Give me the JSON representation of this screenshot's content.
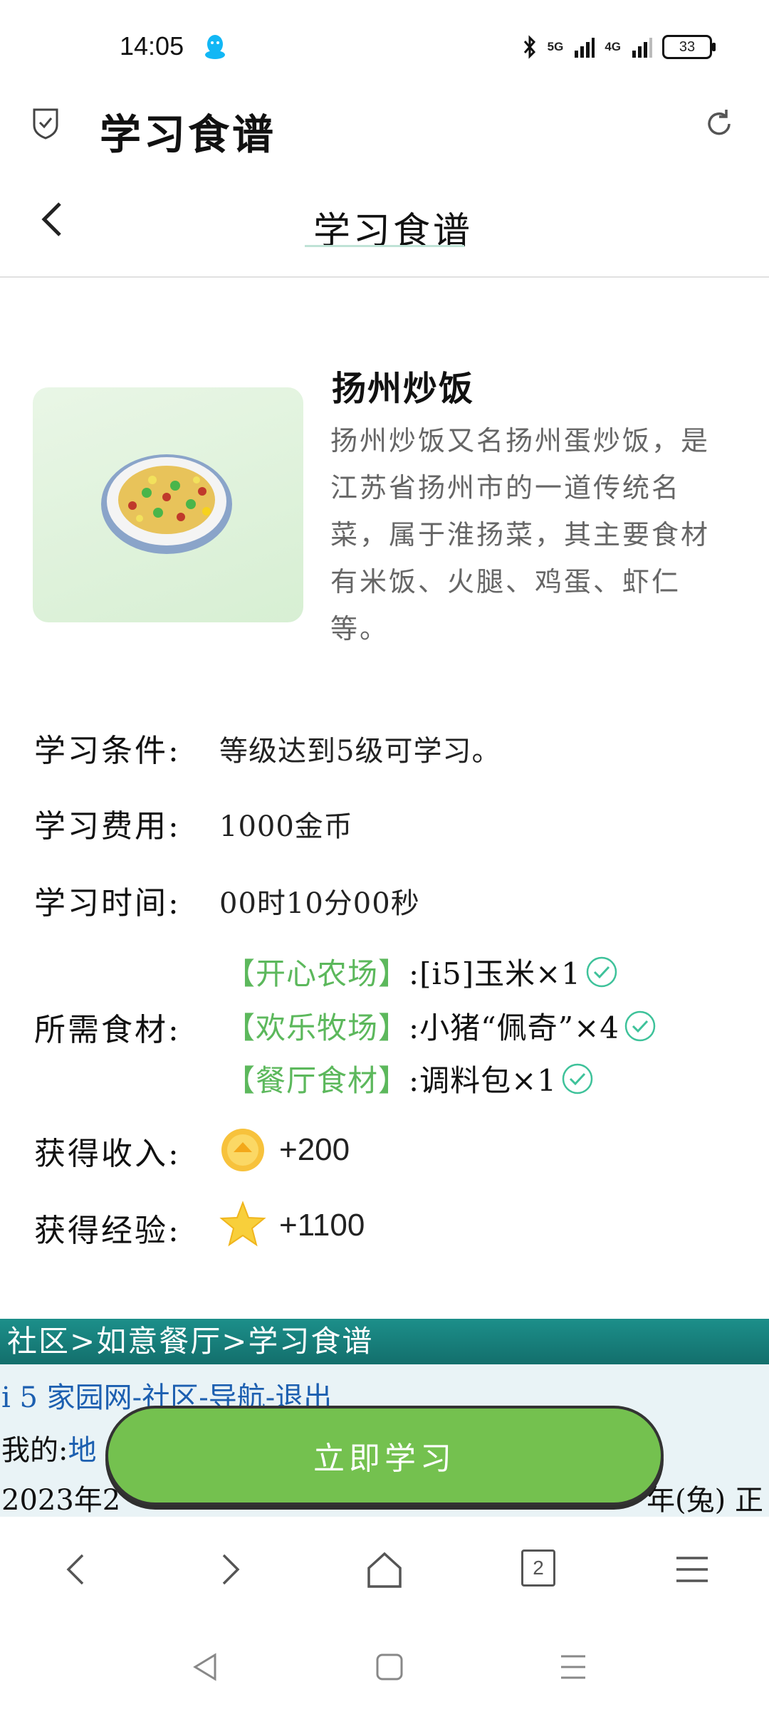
{
  "status": {
    "time": "14:05",
    "net1": "5G",
    "net2": "4G",
    "battery": "33"
  },
  "header": {
    "title": "学习食谱"
  },
  "nav": {
    "title": "学习食谱"
  },
  "recipe": {
    "name": "扬州炒饭",
    "description_lines": [
      "扬州炒饭又名扬州蛋炒饭，是",
      "江苏省扬州市的一道传统名",
      "菜，属于淮扬菜，其主要食材",
      "有米饭、火腿、鸡蛋、虾仁",
      "等。"
    ]
  },
  "condition": {
    "label": "学习条件:",
    "value": "等级达到5级可学习。"
  },
  "cost": {
    "label": "学习费用:",
    "value": "1000金币"
  },
  "time": {
    "label": "学习时间:",
    "value": "00时10分00秒"
  },
  "ingredients": {
    "label": "所需食材:",
    "items": [
      {
        "source": "【开心农场】",
        "item": ":[i5]玉米×1"
      },
      {
        "source": "【欢乐牧场】",
        "item": ":小猪“佩奇”×4"
      },
      {
        "source": "【餐厅食材】",
        "item": ":调料包×1"
      }
    ]
  },
  "income": {
    "label": "获得收入:",
    "value": "+200"
  },
  "exp": {
    "label": "获得经验:",
    "value": "+1100"
  },
  "footer": {
    "breadcrumb": "社区>如意餐厅>学习食谱",
    "site": "i 5 家园网",
    "links": [
      "社区",
      "导航",
      "退出"
    ],
    "sep": "-",
    "mine_label": "我的:",
    "mine_link": "地",
    "date_left": "2023年2",
    "date_right": "年(兔)  正"
  },
  "learn_button": "立即学习",
  "browser": {
    "tab_count": "2"
  }
}
